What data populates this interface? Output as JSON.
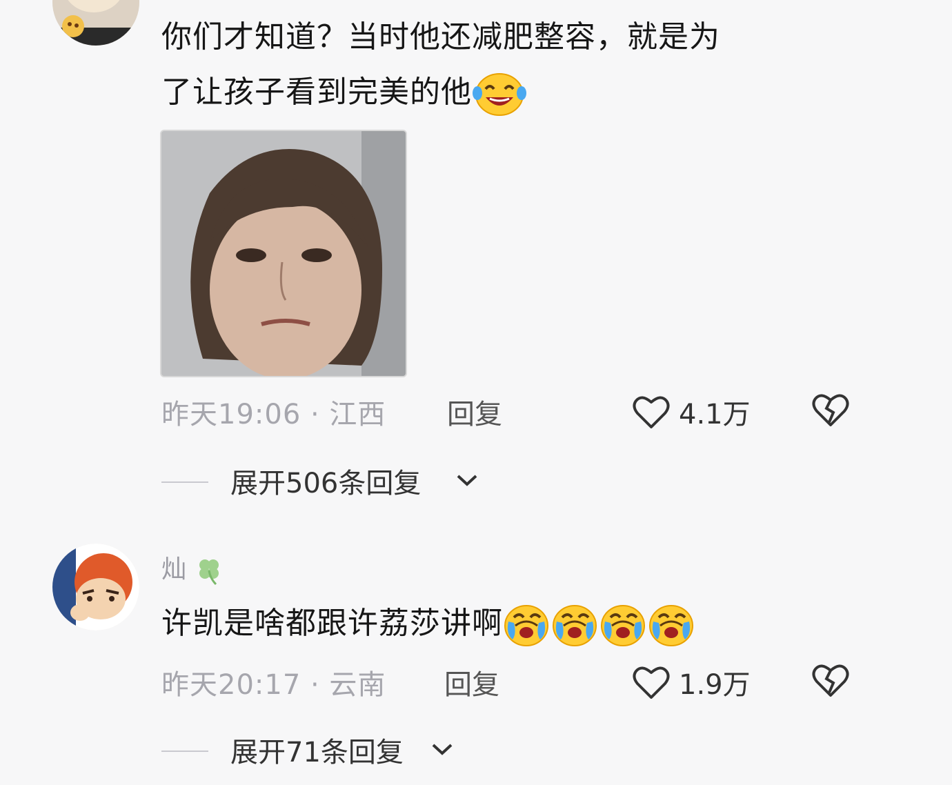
{
  "comments": [
    {
      "username": "",
      "text_line1": "你们才知道？当时他还减肥整容，就是为",
      "text_line2": "了让孩子看到完美的他",
      "time_location": "昨天19:06 · 江西",
      "reply_label": "回复",
      "like_count": "4.1万",
      "expand_label": "展开506条回复",
      "emoji": "laughing-tears-emoji"
    },
    {
      "username": "灿",
      "username_badge": "clover-icon",
      "text": "许凯是啥都跟许荔莎讲啊",
      "time_location": "昨天20:17 · 云南",
      "reply_label": "回复",
      "like_count": "1.9万",
      "expand_label": "展开71条回复",
      "emoji": "crying-emoji",
      "emoji_count": 4
    }
  ],
  "colors": {
    "background": "#f7f7f8",
    "text": "#161616",
    "meta": "#a6a6ad"
  }
}
